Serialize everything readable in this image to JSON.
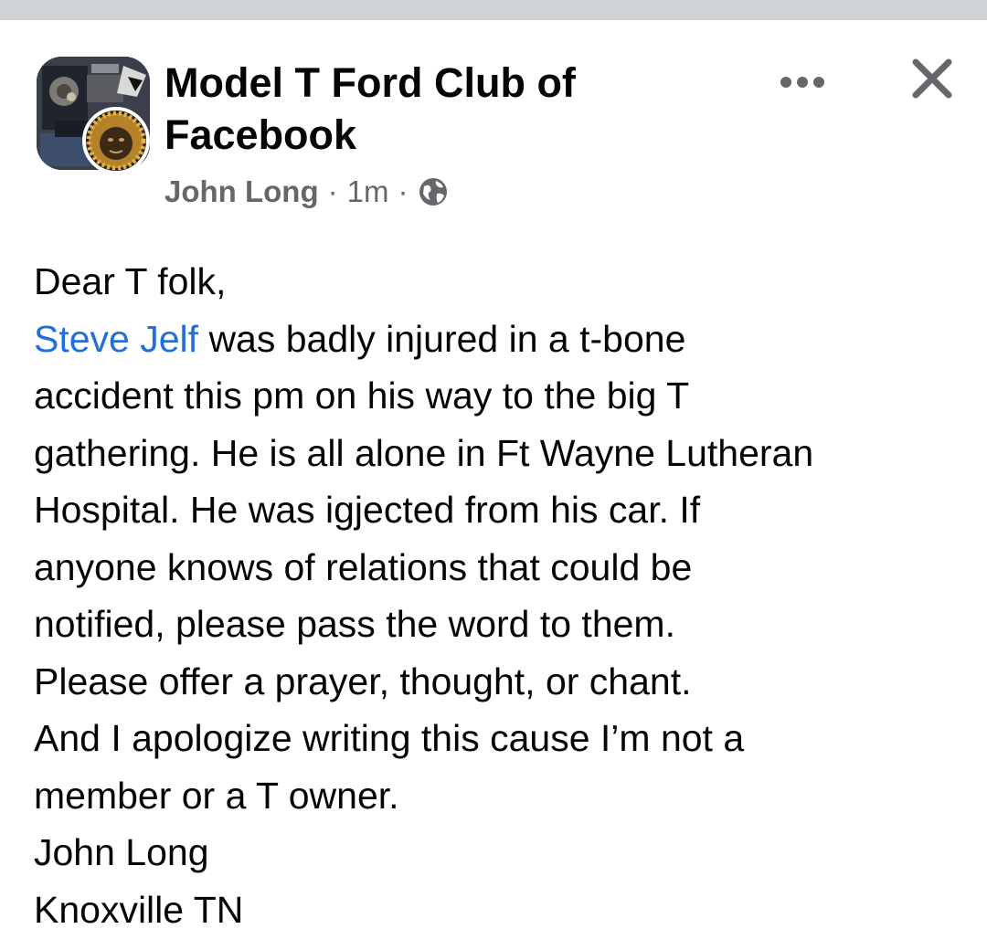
{
  "post": {
    "group_name_line1": "Model T Ford Club of",
    "group_name_line2": "Facebook",
    "author": "John Long",
    "separator": "·",
    "time": "1m",
    "privacy_icon": "globe-icon",
    "more_icon": "more-options-icon",
    "close_icon": "close-icon",
    "body": {
      "greeting": "Dear T folk,",
      "mention": "Steve Jelf",
      "line2_rest": " was badly injured in a t-bone",
      "line3": "accident this pm on his way to the big T",
      "line4": "gathering. He is all alone in Ft Wayne Lutheran",
      "line5": "Hospital. He was igjected from his car. If",
      "line6": "anyone knows of relations that could be",
      "line7": "notified, please pass the word to them.",
      "line8": "Please offer a prayer, thought, or chant.",
      "line9": "And I apologize writing this cause I’m not a",
      "line10": "member or a T owner.",
      "signature_name": "John Long",
      "signature_location": "Knoxville TN"
    }
  },
  "colors": {
    "mention": "#216fdb",
    "meta_text": "#65676b",
    "primary_text": "#050505",
    "top_bar": "#cfd2d6"
  }
}
